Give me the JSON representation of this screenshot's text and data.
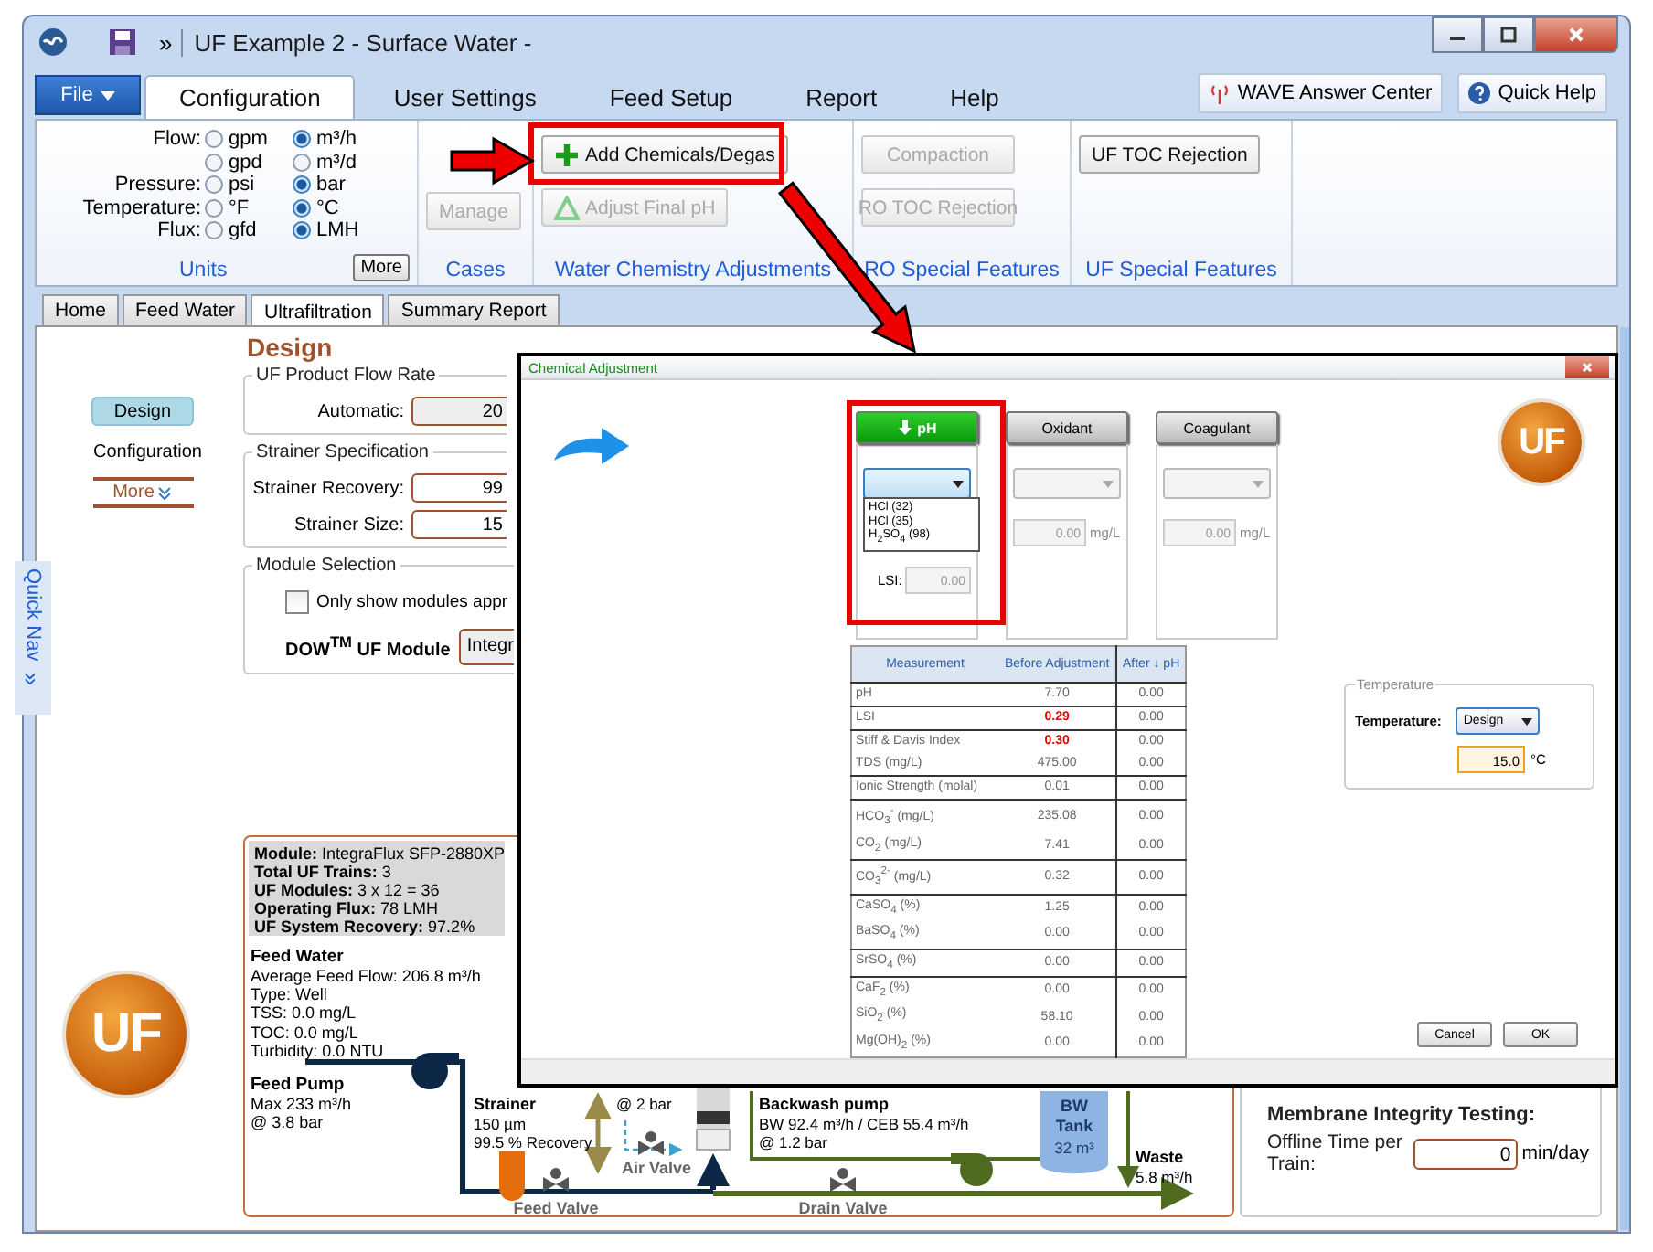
{
  "window": {
    "title": "UF Example 2 - Surface Water -",
    "overflow_glyph": "»"
  },
  "ribbon": {
    "file_button": "File",
    "tabs": [
      {
        "label": "Configuration",
        "selected": true
      },
      {
        "label": "User Settings",
        "selected": false
      },
      {
        "label": "Feed Setup",
        "selected": false
      },
      {
        "label": "Report",
        "selected": false
      },
      {
        "label": "Help",
        "selected": false
      }
    ],
    "help_links": [
      "WAVE Answer Center",
      "Quick Help"
    ],
    "units": {
      "rows": [
        {
          "label": "Flow:",
          "options": [
            {
              "label": "gpm",
              "selected": false
            },
            {
              "label": "m³/h",
              "selected": true
            }
          ]
        },
        {
          "options": [
            {
              "label": "gpd",
              "selected": false
            },
            {
              "label": "m³/d",
              "selected": false
            }
          ]
        },
        {
          "label": "Pressure:",
          "options": [
            {
              "label": "psi",
              "selected": false
            },
            {
              "label": "bar",
              "selected": true
            }
          ]
        },
        {
          "label": "Temperature:",
          "options": [
            {
              "label": "°F",
              "selected": false
            },
            {
              "label": "°C",
              "selected": true
            }
          ]
        },
        {
          "label": "Flux:",
          "options": [
            {
              "label": "gfd",
              "selected": false
            },
            {
              "label": "LMH",
              "selected": true
            }
          ]
        }
      ],
      "more_button": "More",
      "caption": "Units"
    },
    "groups": [
      {
        "caption": "Cases",
        "buttons": [
          {
            "label": "Manage",
            "disabled": true
          }
        ]
      },
      {
        "caption": "Water Chemistry Adjustments",
        "buttons": [
          {
            "label": "Add Chemicals/Degas",
            "disabled": false
          },
          {
            "label": "Adjust Final pH",
            "disabled": true
          }
        ]
      },
      {
        "caption": "RO Special Features",
        "buttons": [
          {
            "label": "Compaction",
            "disabled": true
          },
          {
            "label": "RO TOC Rejection",
            "disabled": true
          }
        ]
      },
      {
        "caption": "UF Special Features",
        "buttons": [
          {
            "label": "UF TOC Rejection",
            "disabled": false
          }
        ]
      }
    ]
  },
  "doc_tabs": [
    {
      "label": "Home",
      "selected": false
    },
    {
      "label": "Feed Water",
      "selected": false
    },
    {
      "label": "Ultrafiltration",
      "selected": true
    },
    {
      "label": "Summary Report",
      "selected": false
    }
  ],
  "quick_nav": {
    "label": "Quick Nav",
    "glyph": "»"
  },
  "nav": {
    "items": [
      {
        "label": "Design",
        "selected": true
      },
      {
        "label": "Configuration",
        "selected": false
      }
    ],
    "more": "More"
  },
  "logo": "UF",
  "design": {
    "heading": "Design",
    "groups": [
      {
        "title": "UF Product Flow Rate",
        "fields": [
          {
            "label": "Automatic:",
            "value": "20",
            "disabled": true
          }
        ]
      },
      {
        "title": "Strainer Specification",
        "fields": [
          {
            "label": "Strainer Recovery:",
            "value": "99",
            "disabled": false
          },
          {
            "label": "Strainer Size:",
            "value": "15",
            "disabled": false
          }
        ]
      }
    ],
    "module_selection": {
      "title": "Module Selection",
      "checkbox": {
        "label": "Only show modules appr",
        "checked": false
      },
      "module_label": "DOW$^{TM}$ UF Module",
      "module_value": "Integr"
    }
  },
  "diagram": {
    "summary": [
      "**Module:** IntegraFlux SFP-2880XP",
      "**Total UF Trains:** 3",
      "**UF Modules:** 3 x 12  =  36",
      "**Operating Flux:**  78 LMH",
      "**UF System Recovery:** 97.2%"
    ],
    "feed_water": {
      "title": "Feed Water",
      "lines": [
        "Average Feed Flow: 206.8 m³/h",
        "Type: Well",
        "TSS: 0.0 mg/L",
        "TOC:  0.0 mg/L",
        "Turbidity: 0.0 NTU"
      ]
    },
    "feed_pump": {
      "title": "Feed Pump",
      "lines": [
        "Max 233 m³/h",
        "@ 3.8 bar"
      ]
    },
    "strainer": {
      "title": "Strainer",
      "lines": [
        "150 µm",
        "99.5 % Recovery"
      ]
    },
    "air_pressure": "@ 2 bar",
    "air_valve": "Air Valve",
    "feed_valve": "Feed Valve",
    "drain_valve": "Drain Valve",
    "backwash_pump": {
      "title": "Backwash pump",
      "lines": [
        "BW 92.4 m³/h / CEB 55.4 m³/h",
        "@ 1.2 bar"
      ]
    },
    "tank": {
      "lines": [
        "BW",
        "Tank"
      ],
      "volume": "32 m³"
    },
    "waste": {
      "title": "Waste",
      "flow": "5.8 m³/h"
    }
  },
  "integrity": {
    "title": "Membrane Integrity Testing:",
    "label": "Offline Time per Train:",
    "value": "0",
    "unit": "min/day"
  },
  "dialog": {
    "title": "Chemical Adjustment",
    "logo": "UF",
    "chemicals": [
      {
        "label": "pH",
        "selected": true,
        "dropdown": {
          "disabled": false,
          "expanded": true,
          "options": [
            "HCl (32)",
            "HCl (35)",
            "H$_{2}$SO$_{4}$ (98)"
          ]
        },
        "field": {
          "label": "LSI:",
          "value": "0.00",
          "disabled": true
        }
      },
      {
        "label": "Oxidant",
        "selected": false,
        "dropdown": {
          "disabled": true,
          "expanded": false
        },
        "field": {
          "value": "0.00",
          "unit": "mg/L",
          "disabled": true
        }
      },
      {
        "label": "Coagulant",
        "selected": false,
        "dropdown": {
          "disabled": true,
          "expanded": false
        },
        "field": {
          "value": "0.00",
          "unit": "mg/L",
          "disabled": true
        }
      }
    ],
    "table": {
      "columns": [
        "Measurement",
        "Before Adjustment",
        "After ↓ pH"
      ],
      "groups": [
        [
          {
            "name": "pH",
            "before": "7.70",
            "after": "0.00",
            "warning": false
          }
        ],
        [
          {
            "name": "LSI",
            "before": "0.29",
            "after": "0.00",
            "warning": true
          }
        ],
        [
          {
            "name": "Stiff & Davis Index",
            "before": "0.30",
            "after": "0.00",
            "warning": true
          },
          {
            "name": "TDS (mg/L)",
            "before": "475.00",
            "after": "0.00",
            "warning": false
          }
        ],
        [
          {
            "name": "Ionic Strength (molal)",
            "before": "0.01",
            "after": "0.00",
            "warning": false
          }
        ],
        [
          {
            "name": "HCO$_{3}$$^{-}$ (mg/L)",
            "before": "235.08",
            "after": "0.00",
            "warning": false
          },
          {
            "name": "CO$_{2}$ (mg/L)",
            "before": "7.41",
            "after": "0.00",
            "warning": false
          }
        ],
        [
          {
            "name": "CO$_{3}$$^{2-}$ (mg/L)",
            "before": "0.32",
            "after": "0.00",
            "warning": false
          }
        ],
        [
          {
            "name": "CaSO$_{4}$ (%)",
            "before": "1.25",
            "after": "0.00",
            "warning": false
          },
          {
            "name": "BaSO$_{4}$ (%)",
            "before": "0.00",
            "after": "0.00",
            "warning": false
          }
        ],
        [
          {
            "name": "SrSO$_{4}$ (%)",
            "before": "0.00",
            "after": "0.00",
            "warning": false
          }
        ],
        [
          {
            "name": "CaF$_{2}$ (%)",
            "before": "0.00",
            "after": "0.00",
            "warning": false
          },
          {
            "name": "SiO$_{2}$ (%)",
            "before": "58.10",
            "after": "0.00",
            "warning": false
          },
          {
            "name": "Mg(OH)$_{2}$ (%)",
            "before": "0.00",
            "after": "0.00",
            "warning": false
          }
        ]
      ]
    },
    "temperature": {
      "legend": "Temperature",
      "label": "Temperature:",
      "mode": "Design",
      "value": "15.0",
      "unit": "°C"
    },
    "buttons": [
      "Cancel",
      "OK"
    ]
  }
}
